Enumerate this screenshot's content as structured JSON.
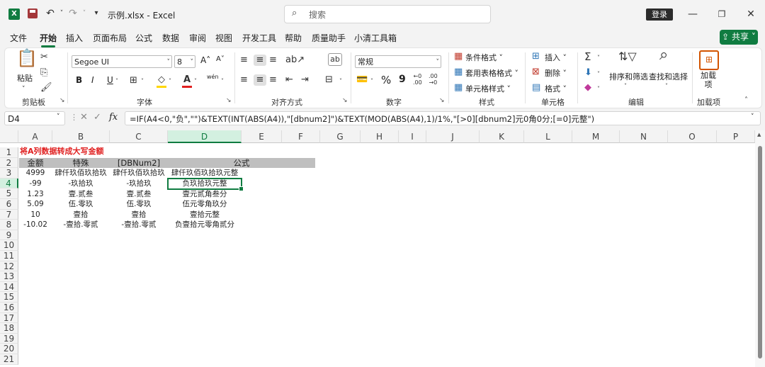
{
  "title_bar": {
    "app_letter": "X",
    "doc_title": "示例.xlsx  -  Excel",
    "search_placeholder": "搜索",
    "login_label": "登录",
    "minimize": "—",
    "restore": "❐",
    "close": "✕"
  },
  "menu": {
    "tabs": [
      "文件",
      "开始",
      "插入",
      "页面布局",
      "公式",
      "数据",
      "审阅",
      "视图",
      "开发工具",
      "帮助",
      "质量助手",
      "小清工具箱"
    ],
    "active_tab": "开始",
    "share_label": "共享"
  },
  "ribbon": {
    "clipboard": {
      "label": "剪贴板",
      "paste": "粘贴"
    },
    "font": {
      "label": "字体",
      "family": "Segoe UI",
      "size": "8",
      "bold": "B",
      "italic": "I",
      "underline": "U",
      "grow": "A˄",
      "shrink": "A˅",
      "phonetic": "wén"
    },
    "alignment": {
      "label": "对齐方式"
    },
    "number": {
      "label": "数字",
      "format": "常规",
      "percent": "%",
      "comma": "9"
    },
    "styles": {
      "label": "样式",
      "conditional": "条件格式",
      "table": "套用表格格式",
      "cell_styles": "单元格样式"
    },
    "cells": {
      "label": "单元格",
      "insert": "插入",
      "delete": "删除",
      "format": "格式"
    },
    "editing": {
      "label": "编辑",
      "sort_filter": "排序和筛选",
      "find_select": "查找和选择"
    },
    "addins": {
      "label": "加载项",
      "add": "加载项"
    }
  },
  "formula_bar": {
    "name_box": "D4",
    "cancel": "✕",
    "confirm": "✓",
    "fx": "fx",
    "formula": "=IF(A4<0,\"负\",\"\")&TEXT(INT(ABS(A4)),\"[dbnum2]\")&TEXT(MOD(ABS(A4),1)/1%,\"[>0][dbnum2]元0角0分;[=0]元整\")"
  },
  "sheet": {
    "columns": [
      "A",
      "B",
      "C",
      "D",
      "E",
      "F",
      "G",
      "H",
      "I",
      "J",
      "K",
      "L",
      "M",
      "N",
      "O",
      "P"
    ],
    "selected_column": "D",
    "rows": [
      "1",
      "2",
      "3",
      "4",
      "5",
      "6",
      "7",
      "8",
      "9",
      "10",
      "11",
      "12",
      "13",
      "14",
      "15",
      "16",
      "17",
      "18",
      "19",
      "20",
      "21"
    ],
    "selected_row": "4",
    "title": "将A列数据转成大写金额",
    "headers": [
      "金额",
      "特殊",
      "[DBNum2]",
      "公式"
    ],
    "data": [
      [
        "4999",
        "肆仟玖佰玖拾玖",
        "肆仟玖佰玖拾玖",
        "肆仟玖佰玖拾玖元整"
      ],
      [
        "-99",
        "-玖拾玖",
        "-玖拾玖",
        "负玖拾玖元整"
      ],
      [
        "1.23",
        "壹.贰叁",
        "壹.贰叁",
        "壹元贰角叁分"
      ],
      [
        "5.09",
        "伍.零玖",
        "伍.零玖",
        "伍元零角玖分"
      ],
      [
        "10",
        "壹拾",
        "壹拾",
        "壹拾元整"
      ],
      [
        "-10.02",
        "-壹拾.零贰",
        "-壹拾.零贰",
        "负壹拾元零角贰分"
      ]
    ]
  }
}
